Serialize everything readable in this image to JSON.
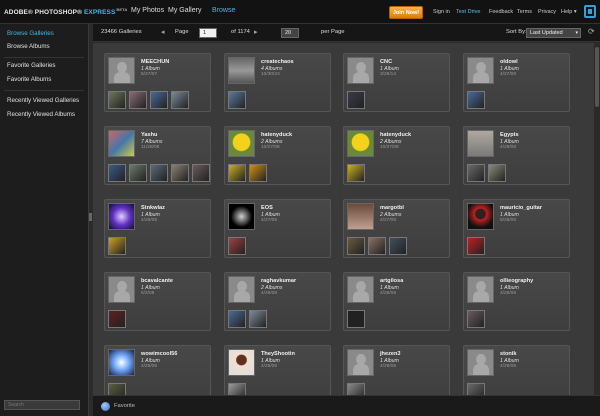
{
  "colors": {
    "accent": "#3fb9e6",
    "join_button": "#ff9f2e"
  },
  "header": {
    "logo_brand": "ADOBE® PHOTOSHOP®",
    "logo_product": "EXPRESS",
    "logo_badge": "BETA",
    "nav": [
      "My Photos",
      "My Gallery",
      "Browse"
    ],
    "join_label": "Join Now!",
    "links": [
      "Sign in",
      "Test Drive",
      "Feedback",
      "Terms",
      "Privacy",
      "Help ▾"
    ]
  },
  "sidebar": {
    "items": [
      "Browse Galleries",
      "Browse Albums",
      "Favorite Galleries",
      "Favorite Albums",
      "Recently Viewed Galleries",
      "Recently Viewed Albums"
    ],
    "search_placeholder": "Search"
  },
  "toolbar": {
    "gallery_count": "23466 Galleries",
    "page_label": "Page",
    "page_value": "1",
    "of_total": "of 1174",
    "per_page_value": "20",
    "per_page_label": "per Page",
    "sort_label": "Sort By:",
    "sort_value": "Last Updated"
  },
  "galleries": [
    {
      "name": "MEECHUN",
      "albums": "1 Album",
      "date": "5/27/07",
      "avatar": "placeholder"
    },
    {
      "name": "createchaos",
      "albums": "4 Albums",
      "date": "10/30/23",
      "avatar": "photo"
    },
    {
      "name": "CNC",
      "albums": "1 Album",
      "date": "3/28/14",
      "avatar": "placeholder"
    },
    {
      "name": "oldowl",
      "albums": "1 Album",
      "date": "4/27/08",
      "avatar": "placeholder"
    },
    {
      "name": "Yashu",
      "albums": "7 Albums",
      "date": "11/28/08",
      "avatar": "photo"
    },
    {
      "name": "hatenyduck",
      "albums": "2 Albums",
      "date": "10/27/08",
      "avatar": "duck"
    },
    {
      "name": "hatenyduck",
      "albums": "2 Albums",
      "date": "10/27/08",
      "avatar": "duck"
    },
    {
      "name": "Egypts",
      "albums": "1 Album",
      "date": "4/29/08",
      "avatar": "photo"
    },
    {
      "name": "Stnkwlaz",
      "albums": "1 Album",
      "date": "4/29/08",
      "avatar": "photo"
    },
    {
      "name": "EOS",
      "albums": "1 Album",
      "date": "4/27/08",
      "avatar": "photo"
    },
    {
      "name": "margotbl",
      "albums": "2 Albums",
      "date": "4/27/08",
      "avatar": "photo"
    },
    {
      "name": "mauricio_guitar",
      "albums": "1 Album",
      "date": "5/28/08",
      "avatar": "photo"
    },
    {
      "name": "bcavalcante",
      "albums": "1 Album",
      "date": "5/2/08",
      "avatar": "placeholder"
    },
    {
      "name": "raghavkumar",
      "albums": "2 Albums",
      "date": "4/29/08",
      "avatar": "placeholder"
    },
    {
      "name": "artgilosa",
      "albums": "1 Album",
      "date": "4/28/08",
      "avatar": "placeholder"
    },
    {
      "name": "ollieography",
      "albums": "1 Album",
      "date": "4/28/08",
      "avatar": "placeholder"
    },
    {
      "name": "wowimcool56",
      "albums": "1 Album",
      "date": "4/29/08",
      "avatar": "photo"
    },
    {
      "name": "TheyShootin",
      "albums": "1 Album",
      "date": "4/29/08",
      "avatar": "photo"
    },
    {
      "name": "jhezen3",
      "albums": "1 Album",
      "date": "4/29/08",
      "avatar": "placeholder"
    },
    {
      "name": "stonik",
      "albums": "1 Album",
      "date": "4/29/08",
      "avatar": "placeholder"
    }
  ],
  "footer": {
    "favorite_label": "Favorite"
  }
}
